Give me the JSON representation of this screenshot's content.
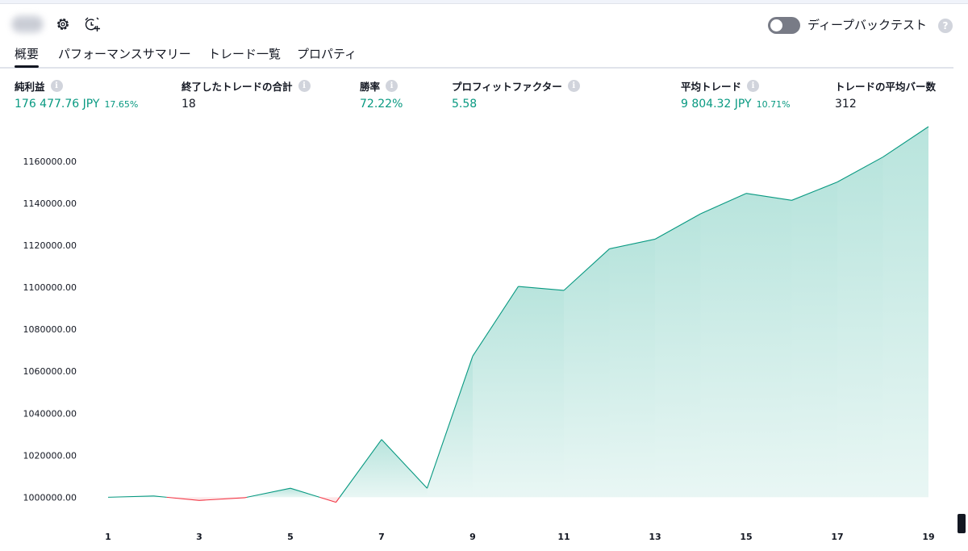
{
  "toolbar": {
    "strategy_name": "~~~",
    "settings_icon": "gear-icon",
    "alert_icon": "alarm-clock-plus-icon",
    "deep_backtest_label": "ディープバックテスト",
    "deep_backtest_enabled": false,
    "help_icon": "question-icon",
    "help_text": "?"
  },
  "tabs": [
    {
      "label": "概要",
      "active": true
    },
    {
      "label": "パフォーマンスサマリー",
      "active": false
    },
    {
      "label": "トレード一覧",
      "active": false
    },
    {
      "label": "プロパティ",
      "active": false
    }
  ],
  "metrics": {
    "net_profit": {
      "label": "純利益",
      "value": "176 477.76 JPY",
      "pct": "17.65%"
    },
    "total_closed_trades": {
      "label": "終了したトレードの合計",
      "value": "18"
    },
    "percent_profitable": {
      "label": "勝率",
      "value": "72.22%"
    },
    "profit_factor": {
      "label": "プロフィットファクター",
      "value": "5.58"
    },
    "avg_trade": {
      "label": "平均トレード",
      "value": "9 804.32 JPY",
      "pct": "10.71%"
    },
    "avg_bars_in_trade": {
      "label": "トレードの平均バー数",
      "value": "312"
    }
  },
  "info_icon_text": "i",
  "colors": {
    "accent_green": "#089981",
    "loss_red": "#f23645",
    "area_fill": "#22ab94",
    "text": "#131722",
    "muted": "#787b86"
  },
  "chart_data": {
    "type": "area",
    "x": [
      1,
      2,
      3,
      4,
      5,
      6,
      7,
      8,
      9,
      10,
      11,
      12,
      13,
      14,
      15,
      16,
      17,
      18,
      19
    ],
    "values": [
      1000000,
      1000600,
      998500,
      999800,
      1004300,
      997600,
      1027500,
      1004300,
      1067200,
      1100400,
      1098500,
      1118300,
      1122900,
      1135000,
      1144700,
      1141400,
      1150100,
      1162000,
      1176478
    ],
    "x_ticks": [
      "1",
      "3",
      "5",
      "7",
      "9",
      "11",
      "13",
      "15",
      "17",
      "19"
    ],
    "y_ticks": [
      "1000000.00",
      "1020000.00",
      "1040000.00",
      "1060000.00",
      "1080000.00",
      "1100000.00",
      "1120000.00",
      "1140000.00",
      "1160000.00"
    ],
    "baseline": 1000000,
    "ylim": [
      994000,
      1176478
    ],
    "xlim": [
      1,
      19
    ],
    "grid": false,
    "title": "",
    "xlabel": "",
    "ylabel": ""
  }
}
